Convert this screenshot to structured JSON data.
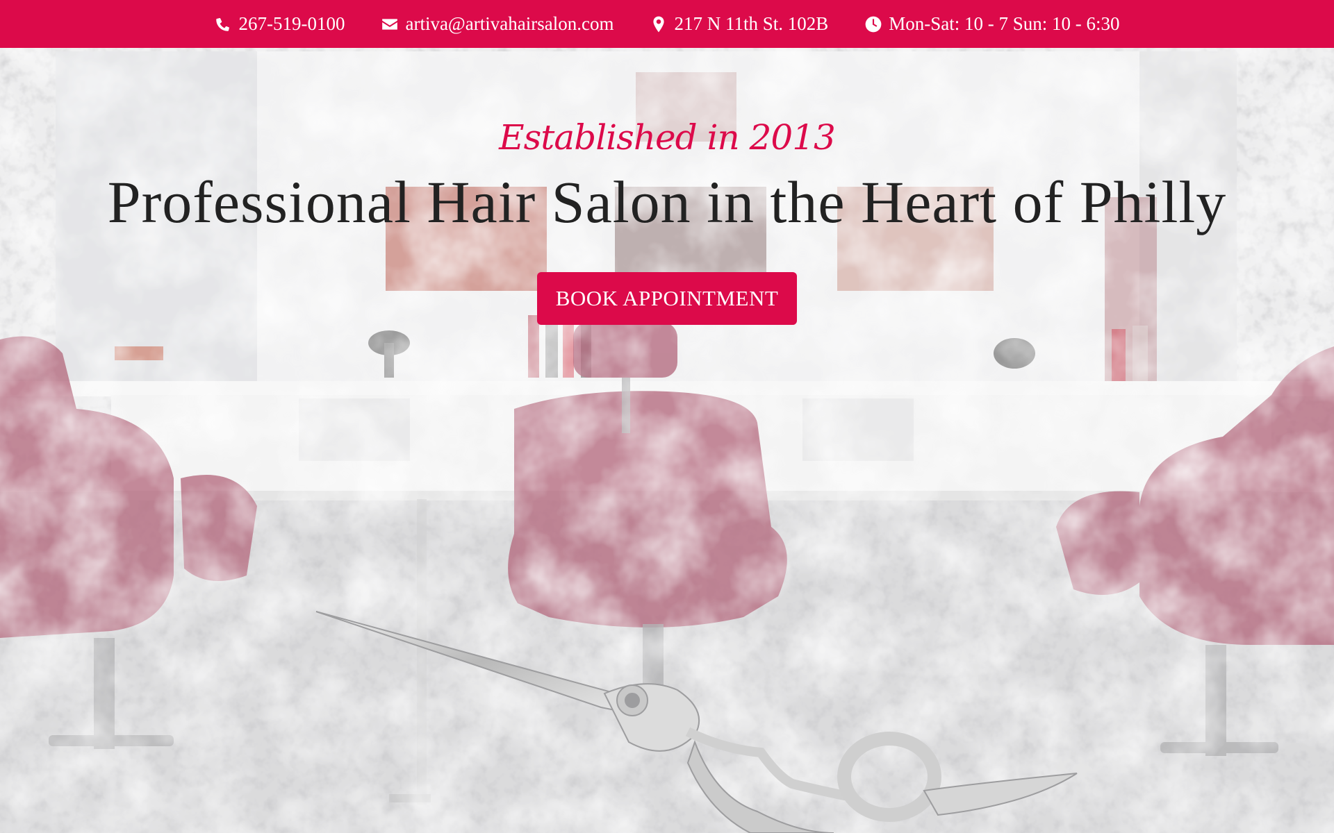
{
  "contact_bar": {
    "phone": "267-519-0100",
    "email": "artiva@artivahairsalon.com",
    "address": "217 N 11th St. 102B",
    "hours": "Mon-Sat: 10 - 7 Sun: 10 - 6:30"
  },
  "hero": {
    "tagline": "Established in 2013",
    "headline": "Professional Hair Salon in the Heart of Philly",
    "cta_label": "BOOK APPOINTMENT"
  },
  "icons": {
    "phone": "phone-icon",
    "email": "envelope-icon",
    "address": "map-pin-icon",
    "hours": "clock-icon"
  },
  "colors": {
    "accent": "#dc0a4a",
    "headline": "#222222",
    "chair": "#9c3a55"
  }
}
